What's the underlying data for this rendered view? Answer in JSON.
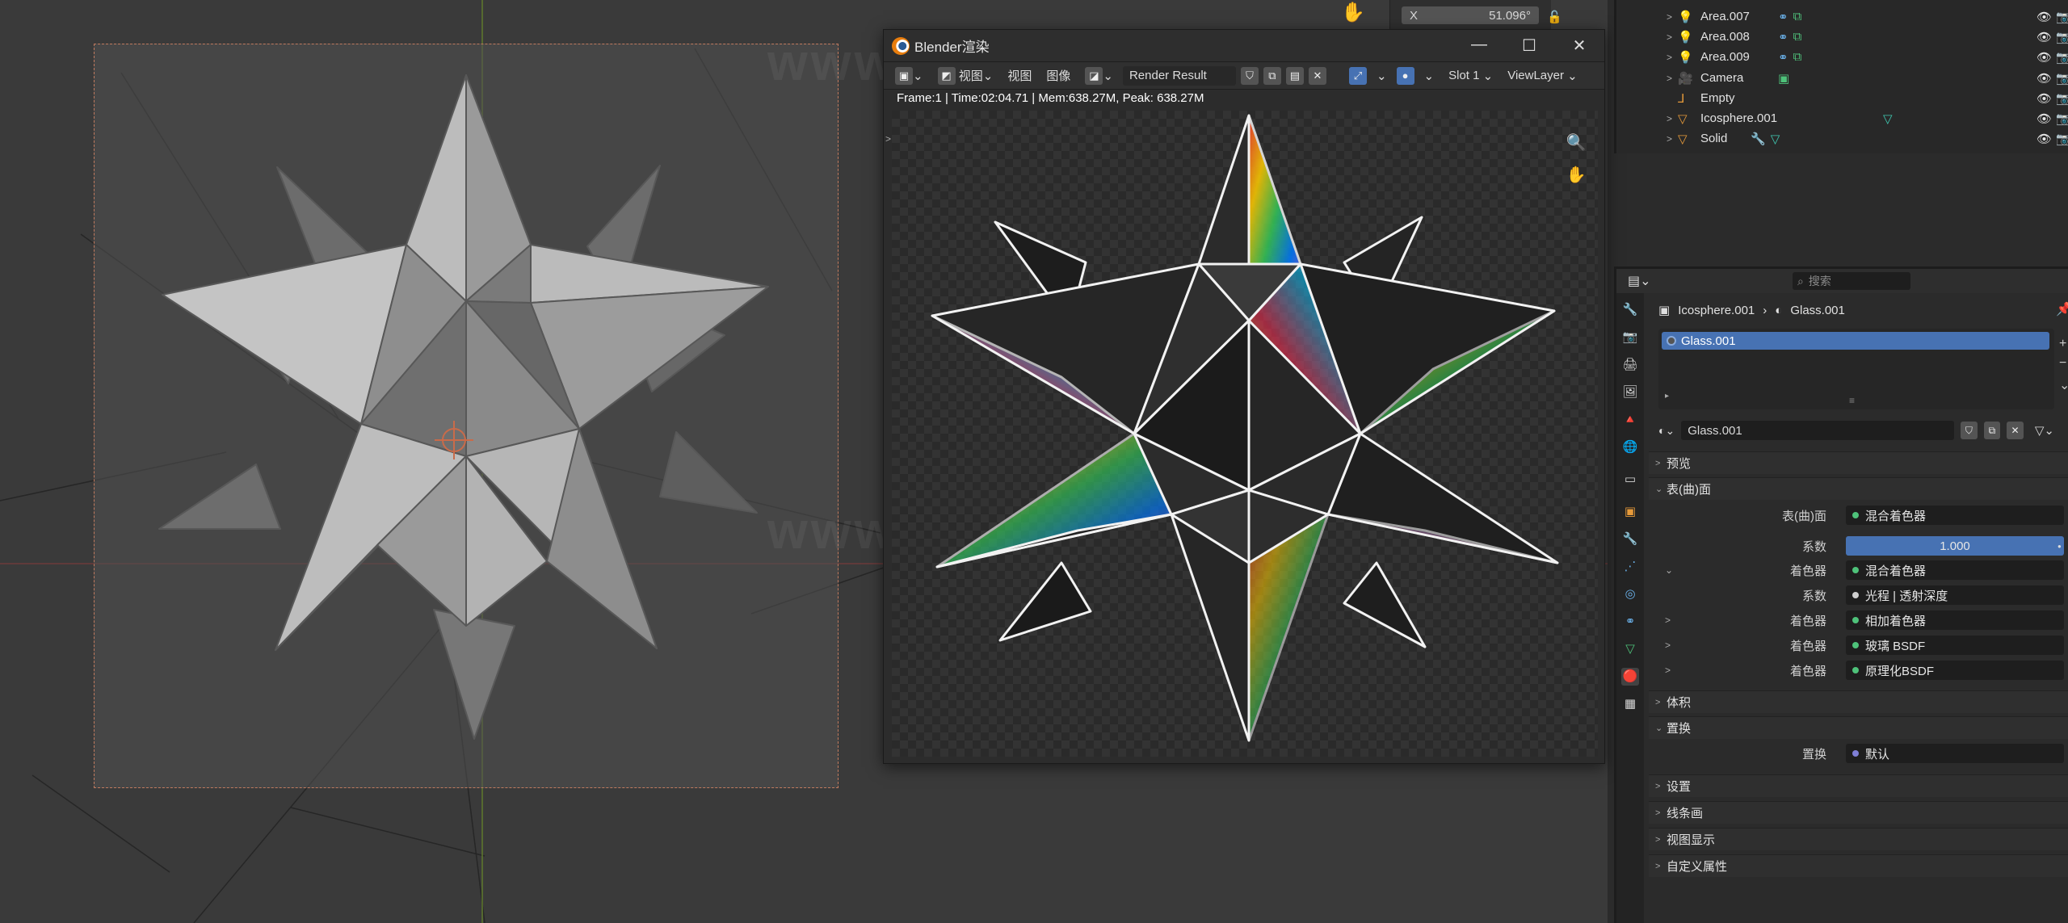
{
  "viewport": {
    "watermark_1": "www.anyusj.com",
    "watermark_2": "www.anyusj.com",
    "npanel": {
      "axis": "X",
      "value": "51.096°"
    }
  },
  "render_window": {
    "title": "Blender渲染",
    "toolbar": {
      "view": "视图",
      "view2": "视图",
      "image": "图像",
      "image_name": "Render Result",
      "slot": "Slot 1",
      "layer": "ViewLayer"
    },
    "stats": "Frame:1 | Time:02:04.71 | Mem:638.27M, Peak: 638.27M"
  },
  "outliner": {
    "items": [
      {
        "name": "Area.007",
        "icon": "light-icon"
      },
      {
        "name": "Area.008",
        "icon": "light-icon"
      },
      {
        "name": "Area.009",
        "icon": "light-icon"
      },
      {
        "name": "Camera",
        "icon": "camera-icon"
      },
      {
        "name": "Empty",
        "icon": "empty-icon"
      },
      {
        "name": "Icosphere.001",
        "icon": "mesh-icon"
      },
      {
        "name": "Solid",
        "icon": "mesh-icon"
      }
    ]
  },
  "properties": {
    "search_placeholder": "搜索",
    "breadcrumb": {
      "object": "Icosphere.001",
      "material": "Glass.001"
    },
    "slot_item": "Glass.001",
    "material_name": "Glass.001",
    "panels": {
      "preview": "预览",
      "surface": "表(曲)面",
      "volume": "体积",
      "displacement": "置换",
      "settings": "设置",
      "lineart": "线条画",
      "viewport_display": "视图显示",
      "custom_props": "自定义属性"
    },
    "rows": {
      "surface_label": "表(曲)面",
      "surface_value": "混合着色器",
      "factor_label": "系数",
      "factor_value": "1.000",
      "shader1_label": "着色器",
      "shader1_value": "混合着色器",
      "factor2_label": "系数",
      "factor2_value": "光程 | 透射深度",
      "shader2_label": "着色器",
      "shader2_value": "相加着色器",
      "shader3_label": "着色器",
      "shader3_value": "玻璃 BSDF",
      "shader4_label": "着色器",
      "shader4_value": "原理化BSDF",
      "disp_label": "置换",
      "disp_value": "默认"
    }
  },
  "colors": {
    "accent": "#4772b3",
    "socket_green": "#4ec27a",
    "orange": "#e69a3a"
  }
}
